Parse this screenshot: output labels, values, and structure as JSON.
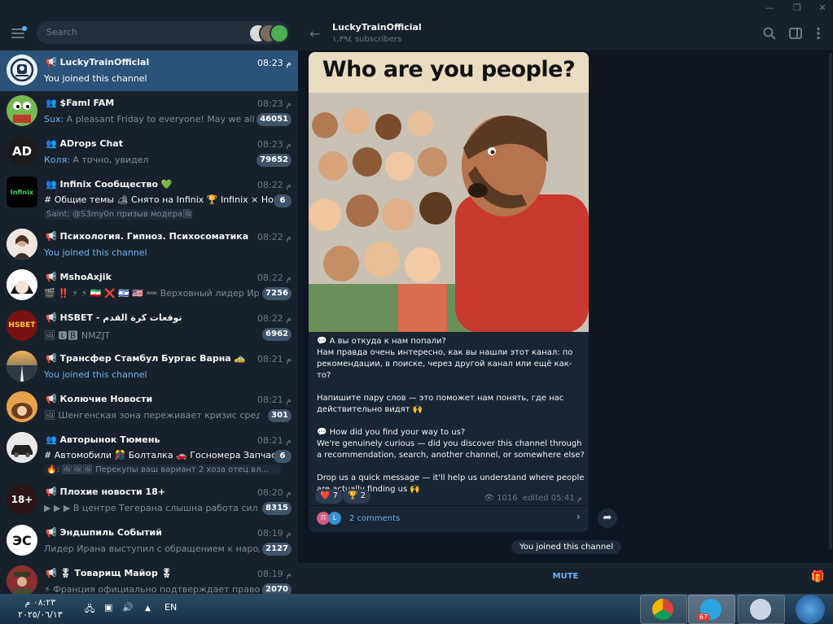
{
  "window": {
    "minimize": "—",
    "maximize": "❐",
    "close": "✕"
  },
  "sidebar": {
    "search_placeholder": "Search",
    "chats": [
      {
        "title": "LuckyTrainOfficial",
        "time": "08:23 م",
        "preview": "You joined this channel",
        "active": true
      },
      {
        "title": "$Faml FAM",
        "time": "08:23 م",
        "sender": "Sux:",
        "preview": "A pleasant Friday to everyone! May we all have ...",
        "badge": "46051"
      },
      {
        "title": "ADrops Chat",
        "time": "08:23 م",
        "sender": "Коля:",
        "preview": "А точно, увидел",
        "badge": "79652"
      },
      {
        "title": "Infinix Сообщество 💚",
        "time": "08:22 م",
        "topics": "# Общие темы   🏕 Снято на Infinix   🏆 Infinix × Hon...",
        "sub": "Saint: @S3my0n призыв модера🖼",
        "badge": "6"
      },
      {
        "title": "Психология. Гипноз. Психосоматика. Инна Ца...",
        "time": "08:22 م",
        "preview": "You joined this channel"
      },
      {
        "title": "MshoAxjik",
        "time": "08:22 م",
        "preview": "🎬 ‼️ ⚡ ⚡ 🇮🇷 ❌ 🇮🇱 🇺🇸 ➖ Верховный лидер Ир...",
        "badge": "7256"
      },
      {
        "title": "HSBET - توقعات كرة القدم",
        "time": "08:22 م",
        "preview": "🖼 🅻🅱 NMZJT",
        "badge": "6962"
      },
      {
        "title": "Трансфер Стамбул Бургас Варна 🚕",
        "time": "08:21 م",
        "preview": "You joined this channel"
      },
      {
        "title": "Колючие Новости",
        "time": "08:21 م",
        "preview": "🖼 Шенгенская зона переживает кризис среднего во...",
        "badge": "301"
      },
      {
        "title": "Авторынок Тюмень",
        "time": "08:21 م",
        "topics": "# Автомобили   🎊 Болталка   🚗 Госномера   Запчаст...",
        "sub": "🔥: 🖼🖼🖼 Перекупы ваш вариант 2 хоза отец вл...",
        "badge": "6"
      },
      {
        "title": "Плохие новости 18+",
        "time": "08:20 م",
        "preview": "▶ ▶ ▶ В центре Тегерана слышна работа сил ПВ...",
        "badge": "8315"
      },
      {
        "title": "Эндшпиль Событий",
        "time": "08:19 م",
        "preview": "Лидер Ирана выступил с обращением к народу. О...",
        "badge": "2127"
      },
      {
        "title": "🎖 Товарищ Майор 🎖",
        "time": "08:19 م",
        "preview": "⚡ Франция официально подтверждает право Изра...",
        "badge": "2070"
      }
    ]
  },
  "channel": {
    "title": "LuckyTrainOfficial",
    "subtitle": "١,٣٩٤ subscribers",
    "post": {
      "image_caption": "Who are you people?",
      "lines": [
        "💬 А вы откуда к нам попали?",
        "Нам правда очень интересно, как вы нашли этот канал: по рекомендации, в поиске, через другой канал или ещё как-то?",
        "",
        "Напишите пару слов — это поможет нам понять, где нас действительно видят 🙌",
        "",
        "💬 How did you find your way to us?",
        "We're genuinely curious — did you discover this channel through a recommendation, search, another channel, or somewhere else?",
        "",
        "Drop us a quick message — it'll help us understand where people are actually finding us 🙌"
      ],
      "reactions": [
        {
          "emoji": "❤️",
          "count": "7"
        },
        {
          "emoji": "🏆",
          "count": "2"
        }
      ],
      "views": "1016",
      "edited": "edited 05:41 م",
      "comment_avatars": [
        "П",
        "L"
      ],
      "comments": "2 comments"
    },
    "service_message": "You joined this channel",
    "mute_label": "MUTE"
  },
  "taskbar": {
    "time": "٠٨:٢٣ م",
    "date": "٢٠٢٥/٠٦/١٣",
    "lang": "EN",
    "telegram_badge": "67"
  }
}
